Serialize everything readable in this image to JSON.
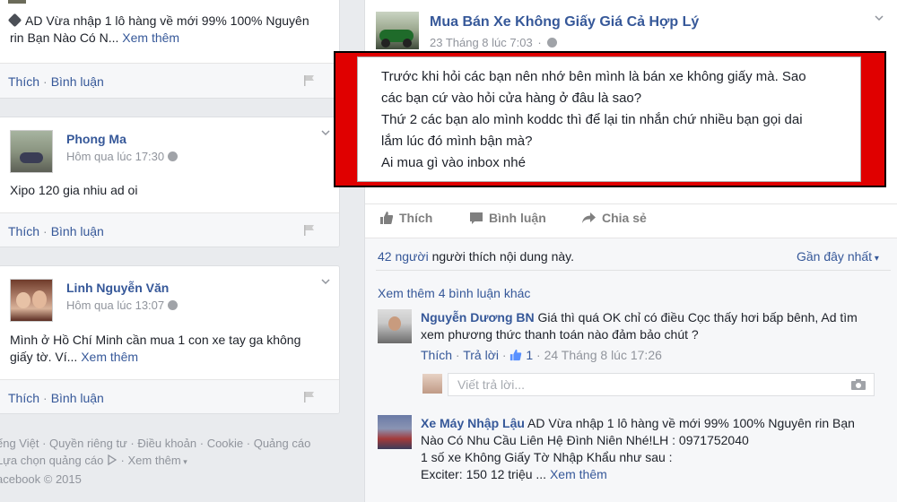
{
  "left": {
    "card1": {
      "text_tail": "AD Vừa nhập 1 lô hàng về mới 99% 100% Nguyên",
      "text_line2": "rin Bạn Nào Có N...",
      "see_more": "Xem thêm",
      "like": "Thích",
      "comment": "Bình luận"
    },
    "card2": {
      "name": "Phong Ma",
      "time": "Hôm qua lúc 17:30",
      "text": "Xipo 120 gia nhiu ad oi",
      "like": "Thích",
      "comment": "Bình luận"
    },
    "card3": {
      "name": "Linh Nguyễn Văn",
      "time": "Hôm qua lúc 13:07",
      "text_line1": "Mình ở Hồ Chí Minh cần mua 1 con xe tay ga không",
      "text_line2": "giấy tờ. Ví...",
      "see_more": "Xem thêm",
      "like": "Thích",
      "comment": "Bình luận"
    },
    "footer": {
      "line1_items": [
        "ếng Việt",
        "Quyền riêng tư",
        "Điều khoản",
        "Cookie",
        "Quảng cáo"
      ],
      "line2_item1": "Lựa chọn quảng cáo",
      "line2_item2": "Xem thêm",
      "copyright": "acebook © 2015"
    }
  },
  "post": {
    "page_name": "Mua Bán Xe Không Giấy Giá Cả Hợp Lý",
    "time": "23 Tháng 8 lúc 7:03",
    "body_lines": [
      "Trước khi hỏi các bạn nên nhớ bên mình là bán xe không giấy mà. Sao",
      "các bạn cứ vào hỏi cửa hàng ở đâu là sao?",
      "Thứ 2 các bạn alo mình koddc thì để lại tin nhắn chứ nhiều bạn gọi dai",
      "lắm lúc đó mình bận mà?",
      "Ai mua gì vào inbox nhé"
    ],
    "actions": {
      "like": "Thích",
      "comment": "Bình luận",
      "share": "Chia sẻ"
    },
    "likes_count": "42 người",
    "likes_text": "người thích nội dung này.",
    "sort_label": "Gần đây nhất",
    "more_comments": "Xem thêm 4 bình luận khác",
    "comment1": {
      "name": "Nguyễn Dương BN",
      "text_line1": "Giá thì quá OK chỉ có điều Cọc thấy hơi bấp bênh, Ad tìm",
      "text_line2": "xem phương thức thanh toán nào đảm bảo chút ?",
      "like": "Thích",
      "reply": "Trả lời",
      "like_count": "1",
      "time": "24 Tháng 8 lúc 17:26"
    },
    "reply_placeholder": "Viết trả lời...",
    "comment2": {
      "name": "Xe Máy Nhập Lậu",
      "text_line1": "AD Vừa nhập 1 lô hàng về mới 99% 100% Nguyên rin Bạn",
      "text_line2": "Nào Có Nhu Cầu Liên Hệ Đình Niên Nhé!LH : 0971752040",
      "text_line3": "1 số xe Không Giấy Tờ Nhập Khẩu như sau :",
      "text_line4": "Exciter: 150 12 triệu ...",
      "see_more": "Xem thêm"
    }
  },
  "colors": {
    "highlight_border": "#e00000",
    "link": "#365899"
  }
}
